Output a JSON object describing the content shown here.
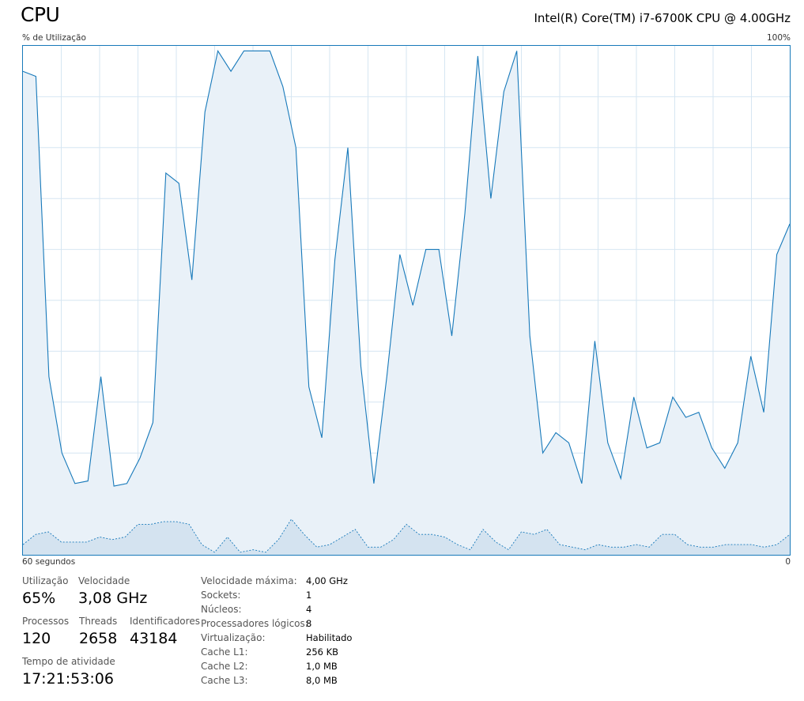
{
  "header": {
    "title": "CPU",
    "cpu_model": "Intel(R) Core(TM) i7-6700K CPU @ 4.00GHz"
  },
  "graph": {
    "y_label": "% de Utilização",
    "y_max_label": "100%",
    "x_left_label": "60 segundos",
    "x_right_label": "0",
    "line_color": "#1779ba",
    "fill_color": "#e9f1f8",
    "grid_color": "#d6e6f2",
    "kernel_fill_color": "#d4e3f0",
    "total_utilization": [
      95,
      94,
      35,
      20,
      14,
      14.5,
      35,
      13.5,
      14,
      19,
      26,
      75,
      73,
      54,
      87,
      99,
      95,
      99,
      99,
      99,
      92,
      80,
      33,
      23,
      58,
      80,
      37,
      14,
      35,
      59,
      49,
      60,
      60,
      43,
      67,
      98,
      70,
      91,
      99,
      43,
      20,
      24,
      22,
      14,
      42,
      22,
      15,
      31,
      21,
      22,
      31,
      27,
      28,
      21,
      17,
      22,
      39,
      28,
      59,
      65
    ],
    "kernel_utilization": [
      2,
      4,
      4.5,
      2.5,
      2.5,
      2.5,
      3.5,
      3,
      3.5,
      6,
      6,
      6.5,
      6.5,
      6,
      2,
      0.5,
      3.5,
      0.5,
      1,
      0.5,
      3,
      7,
      4,
      1.5,
      2,
      3.5,
      5,
      1.5,
      1.5,
      3,
      6,
      4,
      4,
      3.5,
      2,
      1,
      5,
      2.5,
      1,
      4.5,
      4,
      5,
      2,
      1.5,
      1,
      2,
      1.5,
      1.5,
      2,
      1.5,
      4,
      4,
      2,
      1.5,
      1.5,
      2,
      2,
      2,
      1.5,
      2,
      4
    ]
  },
  "stats": {
    "utilization_label": "Utilização",
    "utilization_value": "65%",
    "speed_label": "Velocidade",
    "speed_value": "3,08 GHz",
    "processes_label": "Processos",
    "processes_value": "120",
    "threads_label": "Threads",
    "threads_value": "2658",
    "handles_label": "Identificadores",
    "handles_value": "43184",
    "uptime_label": "Tempo de atividade",
    "uptime_value": "17:21:53:06"
  },
  "info": {
    "max_speed_label": "Velocidade máxima:",
    "max_speed_value": "4,00 GHz",
    "sockets_label": "Sockets:",
    "sockets_value": "1",
    "cores_label": "Núcleos:",
    "cores_value": "4",
    "logical_label": "Processadores lógicos:",
    "logical_value": "8",
    "virtualization_label": "Virtualização:",
    "virtualization_value": "Habilitado",
    "l1_label": "Cache L1:",
    "l1_value": "256 KB",
    "l2_label": "Cache L2:",
    "l2_value": "1,0 MB",
    "l3_label": "Cache L3:",
    "l3_value": "8,0 MB"
  }
}
